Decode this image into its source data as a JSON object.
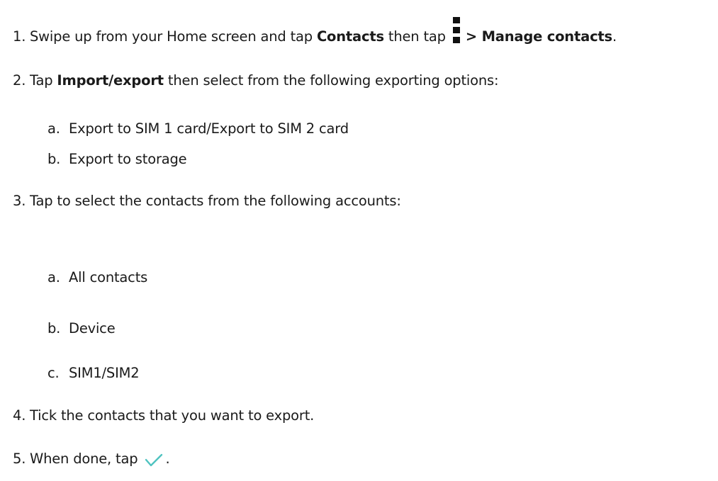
{
  "steps": {
    "s1": {
      "num": "1.",
      "pre": "Swipe up from your Home screen and tap ",
      "bold1": "Contacts",
      "mid": " then tap ",
      "icon": "three-dot-menu-icon",
      "bold2": "> Manage contacts",
      "end": "."
    },
    "s2": {
      "num": "2.",
      "pre": "Tap ",
      "bold1": "Import/export",
      "post": " then select from the following exporting options:",
      "a_label": "a.",
      "a_text": "Export to SIM 1 card/Export to SIM 2 card",
      "b_label": "b.",
      "b_text": "Export to storage"
    },
    "s3": {
      "num": "3.",
      "text": "Tap to select the contacts from the following accounts:",
      "a_label": "a.",
      "a_text": "All contacts",
      "b_label": "b.",
      "b_text": "Device",
      "c_label": "c.",
      "c_text": "SIM1/SIM2"
    },
    "s4": {
      "num": "4.",
      "text": "Tick the contacts that you want to export."
    },
    "s5": {
      "num": "5.",
      "pre": "When done, tap ",
      "icon": "checkmark-icon",
      "icon_color": "#4fc3c0",
      "end": "."
    }
  }
}
